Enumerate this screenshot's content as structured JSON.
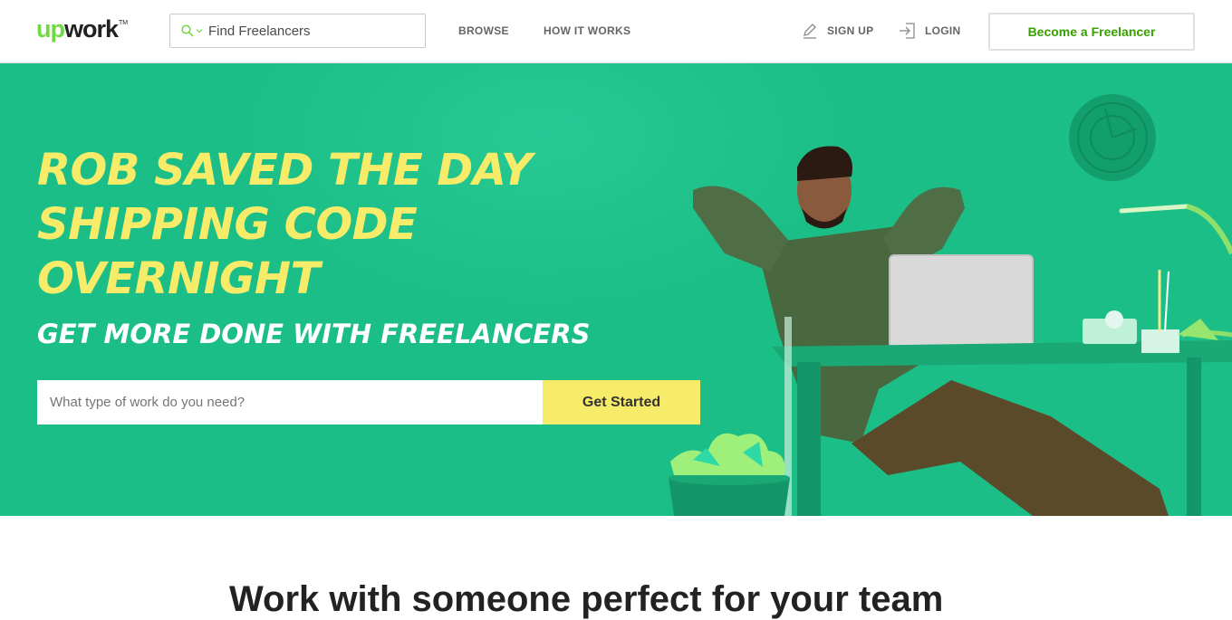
{
  "header": {
    "logo_up": "up",
    "logo_work": "work",
    "logo_tm": "TM",
    "search_value": "Find Freelancers",
    "nav": {
      "browse": "BROWSE",
      "how_it_works": "HOW IT WORKS"
    },
    "signup": "SIGN UP",
    "login": "LOGIN",
    "become_freelancer": "Become a Freelancer"
  },
  "hero": {
    "title_line1": "ROB SAVED THE DAY",
    "title_line2": "SHIPPING CODE",
    "title_line3": "OVERNIGHT",
    "subtitle": "GET MORE DONE WITH FREELANCERS",
    "search_placeholder": "What type of work do you need?",
    "cta": "Get Started",
    "background_color": "#1cbe87",
    "title_color": "#f7ec6a"
  },
  "section": {
    "heading": "Work with someone perfect for your team"
  },
  "colors": {
    "brand_green": "#6fda44",
    "dark_green": "#37a000",
    "cta_yellow": "#f7ec6a"
  }
}
